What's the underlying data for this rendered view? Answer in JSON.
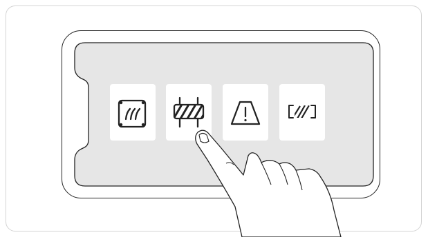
{
  "illustration": {
    "device": "smartphone-landscape",
    "screen_color": "#e6e6e6",
    "tile_color": "#ffffff",
    "stroke_color": "#222222"
  },
  "icons": [
    {
      "name": "heated-windscreen-icon",
      "selected": false
    },
    {
      "name": "road-barrier-icon",
      "selected": true
    },
    {
      "name": "lane-warning-icon",
      "selected": false
    },
    {
      "name": "camera-frame-icon",
      "selected": false
    }
  ],
  "gesture": {
    "type": "tap",
    "target_index": 1
  }
}
